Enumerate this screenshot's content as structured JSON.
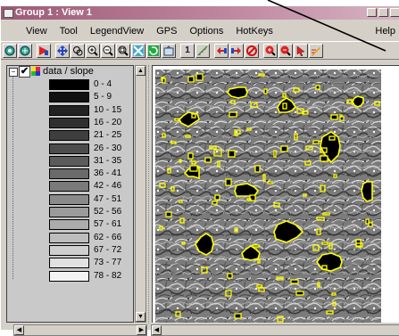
{
  "window": {
    "title": "Group 1 : View 1"
  },
  "menu": {
    "items": [
      "View",
      "Tool",
      "LegendView",
      "GPS",
      "Options",
      "HotKeys"
    ],
    "help": "Help"
  },
  "toolbar": {
    "icons": [
      "view-icon",
      "view-alt-icon",
      "select-icon",
      "pan-icon",
      "zoom-region-icon",
      "zoom-in-icon",
      "zoom-out-icon",
      "zoom-box-icon",
      "full-extent-icon",
      "redraw-icon",
      "overview-icon",
      "scale-one-icon",
      "measure-icon",
      "back-icon",
      "forward-icon",
      "stop-icon",
      "zoom-in-red-icon",
      "zoom-out-red-icon",
      "arrow-pointer-icon",
      "sketch-icon"
    ],
    "scale_one_label": "1",
    "stop_color": "#d01010"
  },
  "legend": {
    "layer_name": "data / slope",
    "checked": true,
    "entries": [
      {
        "label": "0 - 4",
        "color": "#000000"
      },
      {
        "label": "5 - 9",
        "color": "#111111"
      },
      {
        "label": "10 - 15",
        "color": "#222222"
      },
      {
        "label": "16 - 20",
        "color": "#303030"
      },
      {
        "label": "21 - 25",
        "color": "#3e3e3e"
      },
      {
        "label": "26 - 30",
        "color": "#4c4c4c"
      },
      {
        "label": "31 - 35",
        "color": "#5b5b5b"
      },
      {
        "label": "36 - 41",
        "color": "#6a6a6a"
      },
      {
        "label": "42 - 46",
        "color": "#7a7a7a"
      },
      {
        "label": "47 - 51",
        "color": "#8a8a8a"
      },
      {
        "label": "52 - 56",
        "color": "#9b9b9b"
      },
      {
        "label": "57 - 61",
        "color": "#acacac"
      },
      {
        "label": "62 - 66",
        "color": "#bdbdbd"
      },
      {
        "label": "67 - 72",
        "color": "#cfcfcf"
      },
      {
        "label": "73 - 77",
        "color": "#e1e1e1"
      },
      {
        "label": "78 - 82",
        "color": "#f3f3f3"
      }
    ]
  },
  "map": {
    "outline_color": "#ffff00",
    "fill_color": "#000000"
  }
}
